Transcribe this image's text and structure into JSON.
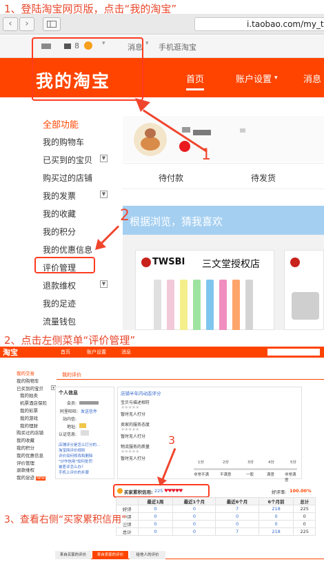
{
  "colors": {
    "brand_orange": "#ff4400",
    "annotation_red": "#e8462a",
    "link_blue": "#3366cc"
  },
  "steps": {
    "step1": "1、登陆淘宝网页版，点击“我的淘宝”",
    "step2": "2、点击左侧菜单“评价管理”",
    "step3": "3、查看右侧“买家累积信用”"
  },
  "browser": {
    "back_icon": "chevron-left-icon",
    "forward_icon": "chevron-right-icon",
    "url": "i.taobao.com/my_ta"
  },
  "site_top": {
    "level_digit": "8",
    "messages": "消息",
    "mobile": "手机逛淘宝"
  },
  "header": {
    "logo": "我的淘宝",
    "nav_home": "首页",
    "nav_account": "账户设置",
    "nav_msg": "消息"
  },
  "sidebar": {
    "title": "全部功能",
    "items": [
      "我的购物车",
      "已买到的宝贝",
      "购买过的店铺",
      "我的发票",
      "我的收藏",
      "我的积分",
      "我的优惠信息",
      "评价管理",
      "退款维权",
      "我的足迹",
      "流量钱包"
    ]
  },
  "order_tabs": {
    "pending_pay": "待付款",
    "pending_ship": "待发货"
  },
  "recommend": {
    "text": "根据浏览，猜我喜欢"
  },
  "products": {
    "brand": "TWSBI",
    "shop_label": "三文堂授权店"
  },
  "annotations": {
    "n1": "1",
    "n2": "2",
    "n3": "3"
  },
  "panel2": {
    "logo": "淘宝",
    "nav_home": "首页",
    "nav_account": "账户设置",
    "nav_msg": "消息",
    "left_menu": [
      "我的交易",
      "我的购物车",
      "已买到的宝贝",
      "我的拍卖",
      "机票酒店保险",
      "我的彩票",
      "我的游戏",
      "我的理财",
      "购买过的店铺",
      "我的收藏",
      "我的积分",
      "我的优惠信息",
      "评价管理",
      "退款维权",
      "我的足迹"
    ],
    "new_badge": "NEW",
    "tab_my_reviews": "我的评价",
    "personal_info_title": "个人信息",
    "info_labels": [
      "会员:",
      "阿里旺旺:",
      "站内信:",
      "地址:",
      "认证信息:"
    ],
    "send_msg": "发送信件",
    "help_links": [
      "店铺评分是怎么打分的...",
      "淘宝网评价规则",
      "评价如何修改和删除",
      "\"炒作信用\"如何处罚",
      "被差评怎么办？",
      "手机上评价的步骤"
    ],
    "shop_score_title": "店铺半年内动态评分",
    "score_items": [
      {
        "label": "宝贝与描述相符",
        "note": "暂时无人打分"
      },
      {
        "label": "卖家的服务态度",
        "note": "暂时无人打分"
      },
      {
        "label": "物流服务的质量",
        "note": "暂时无人打分"
      }
    ],
    "scale_scores": [
      "1分",
      "2分",
      "3分",
      "4分",
      "5分"
    ],
    "scale_labels": [
      "非常不满",
      "不满意",
      "一般",
      "满意",
      "非常满意"
    ],
    "buyer_credit_label": "买家累积信用:",
    "buyer_credit_value": "225",
    "good_rate_label": "好评率:",
    "good_rate_value": "100.00%",
    "table_headers": [
      "",
      "最近1周",
      "最近1个月",
      "最近6个月",
      "6个月前",
      "总计"
    ],
    "table_rows": [
      {
        "label": "好评",
        "values": [
          "0",
          "0",
          "7",
          "218",
          "225"
        ]
      },
      {
        "label": "中评",
        "values": [
          "0",
          "0",
          "0",
          "0",
          "0"
        ]
      },
      {
        "label": "差评",
        "values": [
          "0",
          "0",
          "0",
          "0",
          "0"
        ]
      },
      {
        "label": "总计",
        "values": [
          "0",
          "0",
          "7",
          "218",
          "225"
        ]
      }
    ],
    "bottom_tabs": [
      "来自买家的评价",
      "来自卖家的评价",
      "给他人的评价"
    ]
  }
}
